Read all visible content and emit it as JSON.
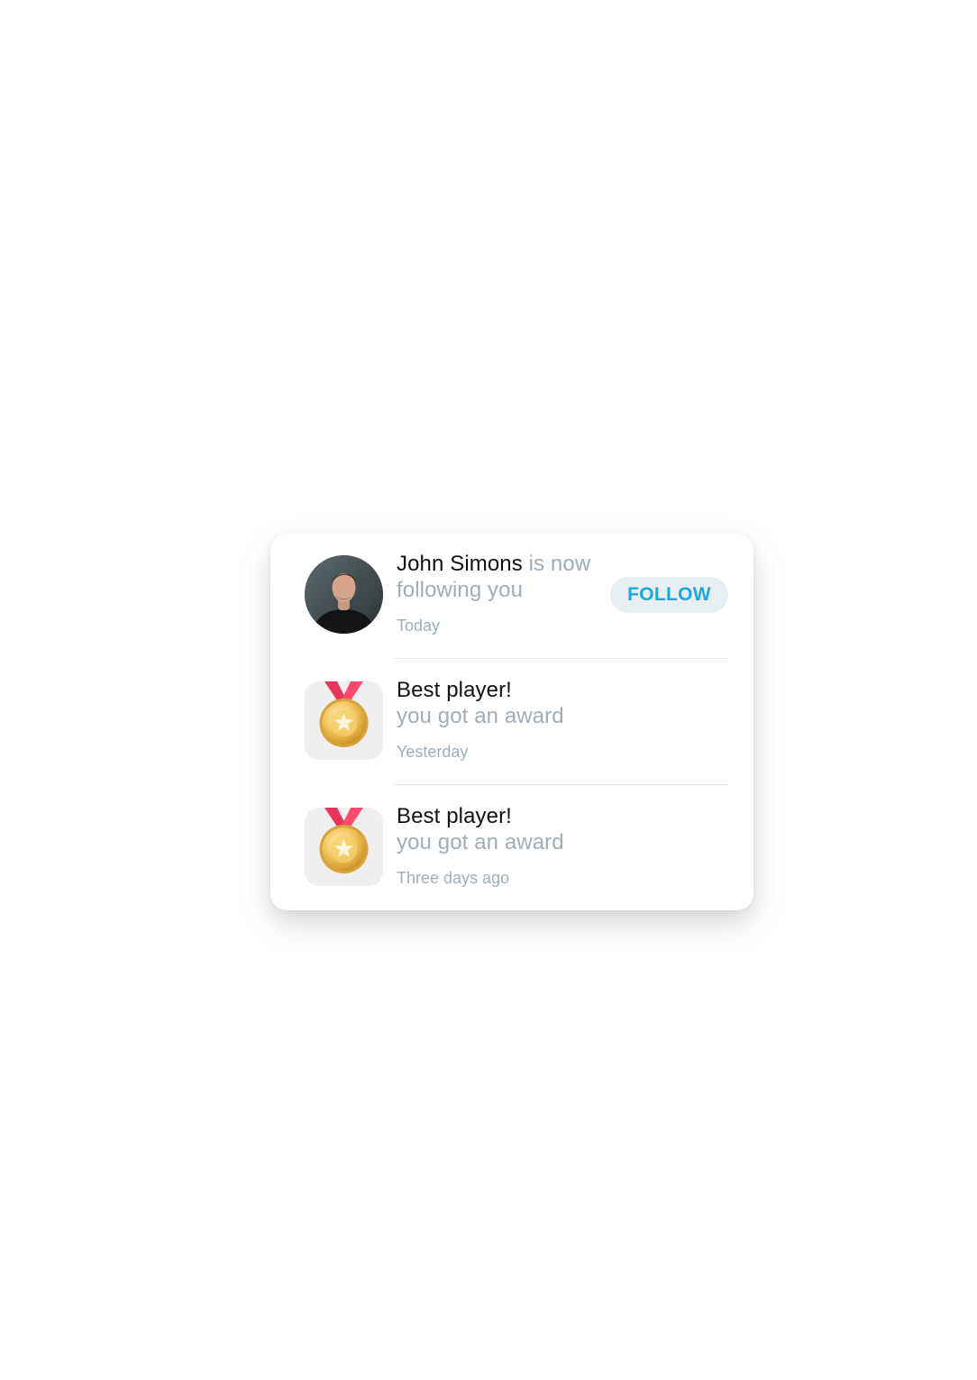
{
  "notifications": [
    {
      "type": "follow",
      "name": "John Simons",
      "message_inline": "is now",
      "message_line2": "following you",
      "time": "Today",
      "action_label": "FOLLOW",
      "icon": "user-avatar"
    },
    {
      "type": "award",
      "title": "Best player!",
      "message": "you got an award",
      "time": "Yesterday",
      "icon": "medal-icon"
    },
    {
      "type": "award",
      "title": "Best player!",
      "message": "you got an award",
      "time": "Three days ago",
      "icon": "medal-icon"
    }
  ],
  "colors": {
    "accent": "#1aa8e3",
    "button_bg": "#e8eff3",
    "muted_text": "#9fadb8",
    "ribbon": "#e8335a",
    "gold": "#e6b84a"
  }
}
